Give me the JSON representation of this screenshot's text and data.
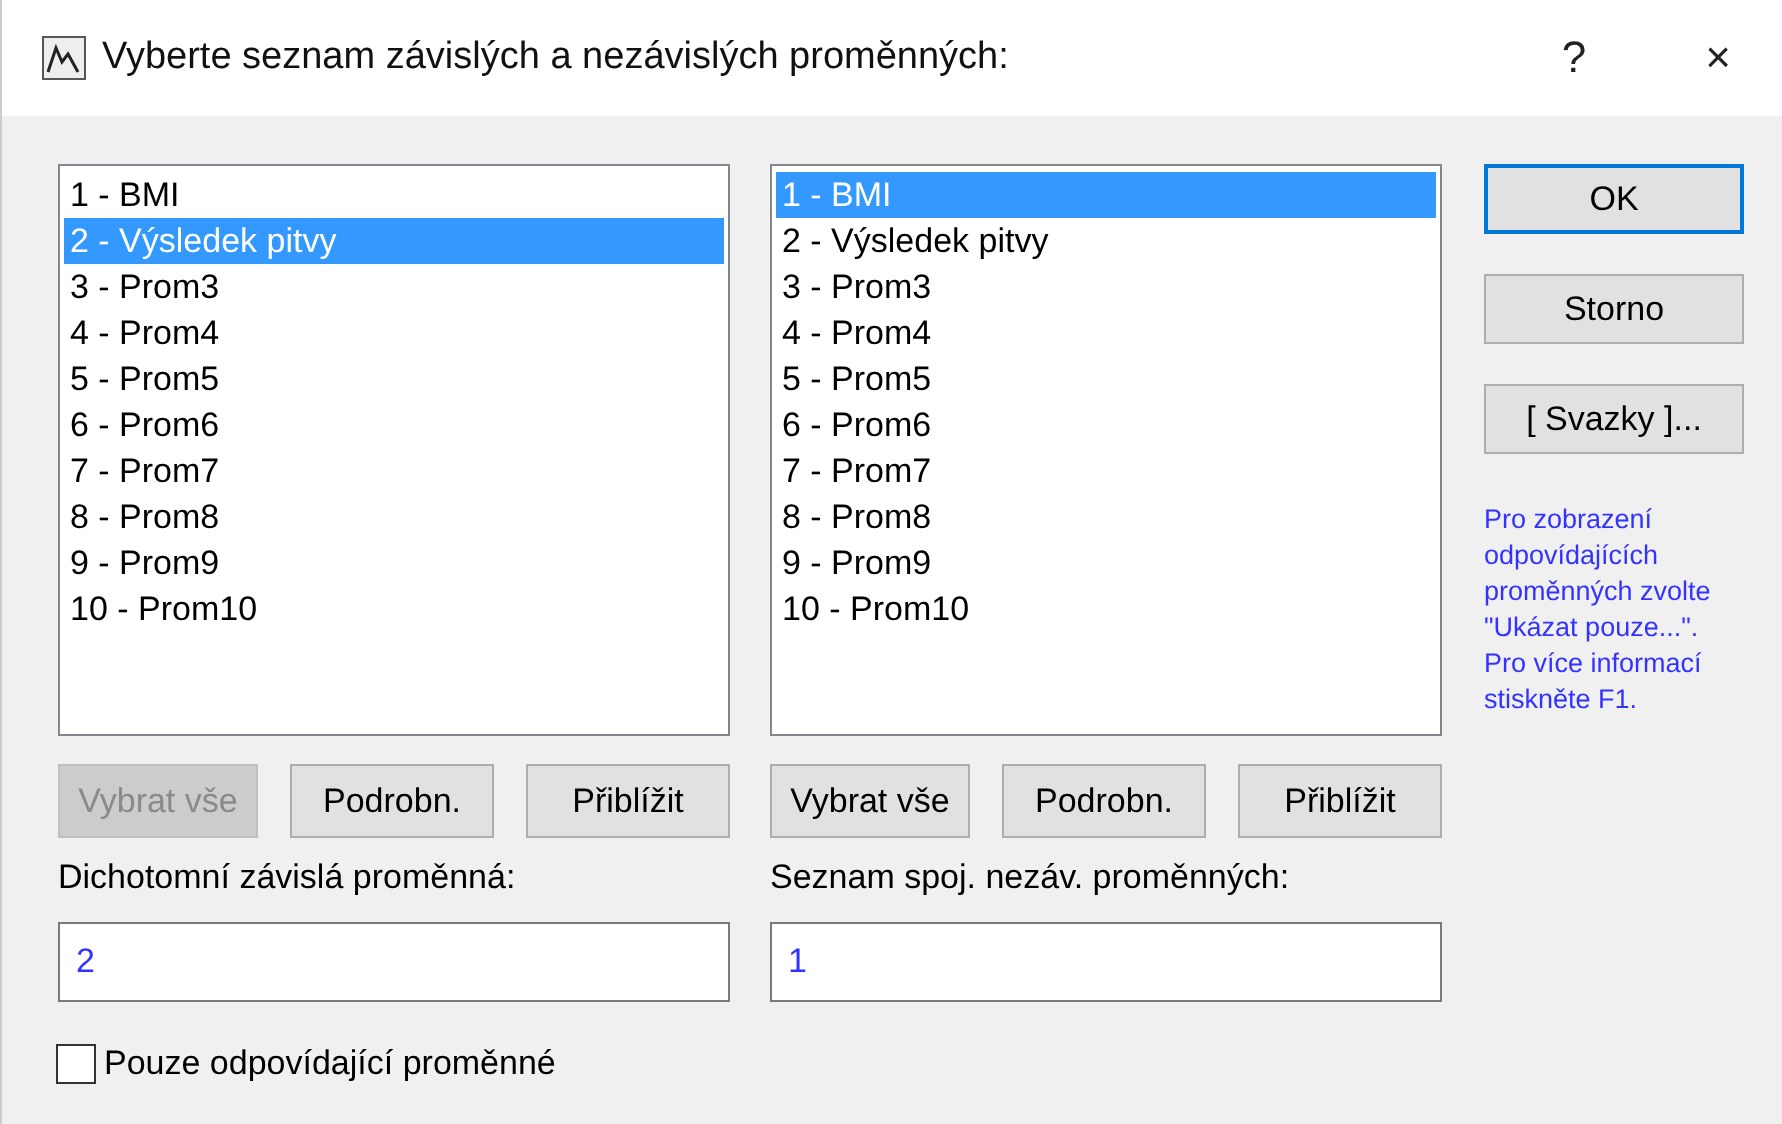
{
  "window": {
    "title": "Vyberte seznam závislých a nezávislých proměnných:",
    "help_button": "?",
    "close_button": "×"
  },
  "panels": [
    {
      "items": [
        {
          "label": "1 - BMI",
          "selected": false
        },
        {
          "label": "2 - Výsledek pitvy",
          "selected": true
        },
        {
          "label": "3 - Prom3",
          "selected": false
        },
        {
          "label": "4 - Prom4",
          "selected": false
        },
        {
          "label": "5 - Prom5",
          "selected": false
        },
        {
          "label": "6 - Prom6",
          "selected": false
        },
        {
          "label": "7 - Prom7",
          "selected": false
        },
        {
          "label": "8 - Prom8",
          "selected": false
        },
        {
          "label": "9 - Prom9",
          "selected": false
        },
        {
          "label": "10 - Prom10",
          "selected": false
        }
      ],
      "buttons": [
        {
          "label": "Vybrat vše",
          "disabled": true
        },
        {
          "label": "Podrobn.",
          "disabled": false
        },
        {
          "label": "Přiblížit",
          "disabled": false
        }
      ],
      "field_label": "Dichotomní závislá proměnná:",
      "value": "2"
    },
    {
      "items": [
        {
          "label": "1 - BMI",
          "selected": true
        },
        {
          "label": "2 - Výsledek pitvy",
          "selected": false
        },
        {
          "label": "3 - Prom3",
          "selected": false
        },
        {
          "label": "4 - Prom4",
          "selected": false
        },
        {
          "label": "5 - Prom5",
          "selected": false
        },
        {
          "label": "6 - Prom6",
          "selected": false
        },
        {
          "label": "7 - Prom7",
          "selected": false
        },
        {
          "label": "8 - Prom8",
          "selected": false
        },
        {
          "label": "9 - Prom9",
          "selected": false
        },
        {
          "label": "10 - Prom10",
          "selected": false
        }
      ],
      "buttons": [
        {
          "label": "Vybrat vše",
          "disabled": false
        },
        {
          "label": "Podrobn.",
          "disabled": false
        },
        {
          "label": "Přiblížit",
          "disabled": false
        }
      ],
      "field_label": "Seznam spoj. nezáv. proměnných:",
      "value": "1"
    }
  ],
  "actions": [
    {
      "label": "OK",
      "default": true
    },
    {
      "label": "Storno",
      "default": false
    },
    {
      "label": "[ Svazky ]...",
      "default": false
    }
  ],
  "help_text": "Pro zobrazení odpovídajících proměnných zvolte \"Ukázat pouze...\". Pro více informací stiskněte F1.",
  "checkbox": {
    "label": "Pouze odpovídající proměnné",
    "checked": false
  }
}
